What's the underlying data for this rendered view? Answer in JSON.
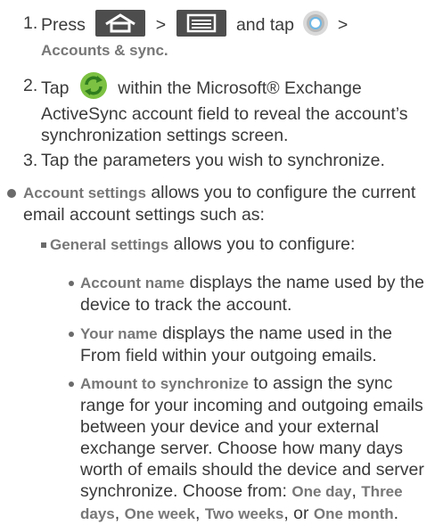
{
  "steps": [
    {
      "number": "1.",
      "press": "Press",
      "gt1": ">",
      "and_tap": "and tap",
      "gt2": ">",
      "path": "Accounts & sync."
    },
    {
      "number": "2.",
      "tap": "Tap",
      "line1_rest": "within the Microsoft® Exchange",
      "line2": "ActiveSync account field to reveal the account’s",
      "line3": "synchronization settings screen."
    },
    {
      "number": "3.",
      "text": "Tap the parameters you wish to synchronize."
    }
  ],
  "account_settings": {
    "term": "Account settings",
    "line1_rest": "allows you to configure the current",
    "line2": "email account settings such as:"
  },
  "general_settings": {
    "term": "General settings",
    "rest": "allows you to configure:"
  },
  "items": [
    {
      "term": "Account name",
      "line1_rest": "displays the name used by the",
      "line2": "device to track the account."
    },
    {
      "term": "Your name",
      "line1_rest": "displays the name used in the",
      "line2": "From field within your outgoing emails."
    },
    {
      "term": "Amount to synchronize",
      "line1_rest": "to assign the sync",
      "line2": "range for your incoming and outgoing emails",
      "line3": "between your device and your external",
      "line4": "exchange server. Choose how many days",
      "line5": "worth of emails should the device and server",
      "line6_start": "synchronize. Choose from:",
      "options": [
        "One day",
        "Three days",
        "One week",
        "Two weeks",
        "One month"
      ],
      "opt_sep": ",",
      "opt_or": "or",
      "end_period": "."
    }
  ],
  "icons": {
    "home": "home-icon",
    "menu": "menu-icon",
    "settings": "settings-gear-icon",
    "sync": "sync-icon"
  },
  "colors": {
    "text": "#3a3a3a",
    "bold": "#777777",
    "hw_button": "#4d4d4d",
    "sync_green": "#7cc142",
    "sync_dark": "#2f7d1e"
  }
}
